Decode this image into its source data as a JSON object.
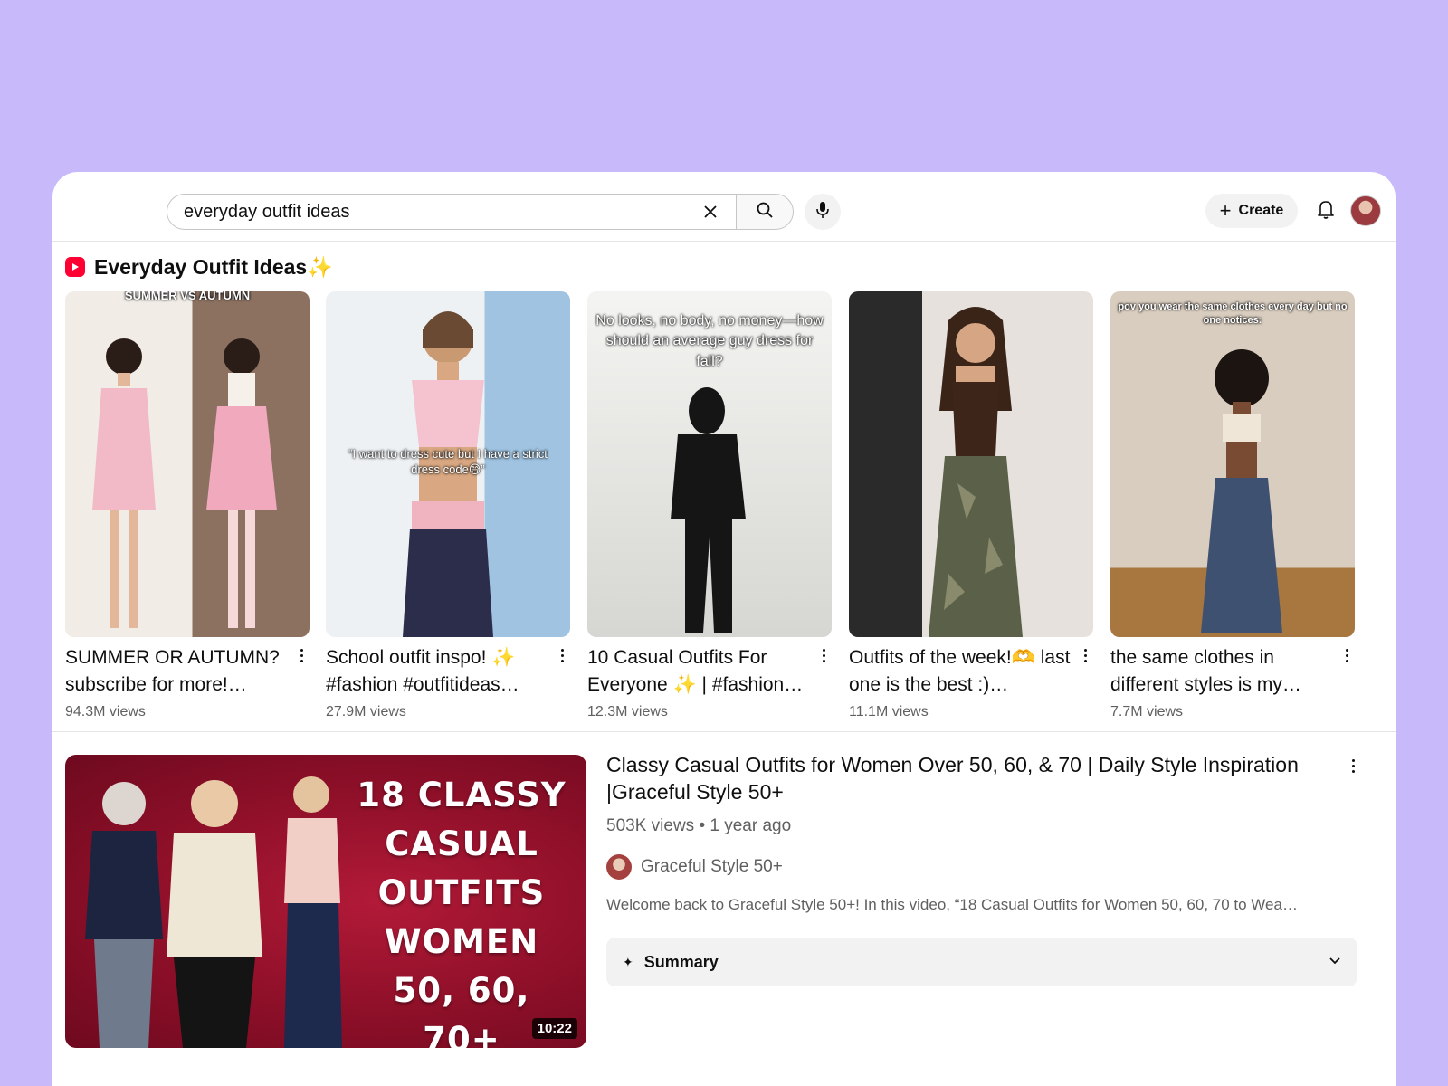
{
  "search": {
    "query": "everyday outfit ideas",
    "clear_icon": "close-icon",
    "search_icon": "search-icon",
    "mic_icon": "mic-icon"
  },
  "header": {
    "create_label": "Create",
    "bell_icon": "bell-icon"
  },
  "shelf": {
    "title": "Everyday Outfit Ideas",
    "title_emoji": "✨",
    "shorts": [
      {
        "title": "SUMMER OR AUTUMN? subscribe for more!…",
        "views": "94.3M views",
        "caption": "SUMMER VS AUTUMN",
        "bg_top": "#f1ece6",
        "bg_bottom": "#c9b6a8"
      },
      {
        "title": "School outfit inspo! ✨ #fashion #outfitideas…",
        "views": "27.9M views",
        "caption": "“I want to dress cute but I have a strict dress code😅”",
        "bg_top": "#e9eef2",
        "bg_bottom": "#b9c4cc"
      },
      {
        "title": "10 Casual Outfits For Everyone ✨ | #fashion…",
        "views": "12.3M views",
        "caption": "No looks, no body, no money—how should an average guy dress for fall?",
        "bg_top": "#f3f3f1",
        "bg_bottom": "#cfcfcb"
      },
      {
        "title": "Outfits of the week!🫶 last one is the best :)…",
        "views": "11.1M views",
        "caption": "",
        "bg_top": "#d9d4cf",
        "bg_bottom": "#8a7d70"
      },
      {
        "title": "the same clothes in different styles is my…",
        "views": "7.7M views",
        "caption": "pov you wear the same clothes every day but no one notices:",
        "bg_top": "#d7cbbd",
        "bg_bottom": "#a88355"
      }
    ]
  },
  "video": {
    "title": "Classy Casual Outfits for Women Over 50, 60, & 70 | Daily Style Inspiration |Graceful Style 50+",
    "meta": "503K views • 1 year ago",
    "channel": "Graceful Style 50+",
    "description": "Welcome back to Graceful Style 50+! In this video, “18 Casual Outfits for Women 50, 60, 70 to Wea…",
    "thumbnail_headline": [
      "18 CLASSY",
      "CASUAL",
      "OUTFITS",
      "WOMEN",
      "50, 60, 70+"
    ],
    "duration": "10:22",
    "summary_label": "Summary"
  },
  "colors": {
    "background": "#c8b9fb",
    "shorts_red": "#ff0033",
    "thumb_red": "#8d0f28"
  }
}
